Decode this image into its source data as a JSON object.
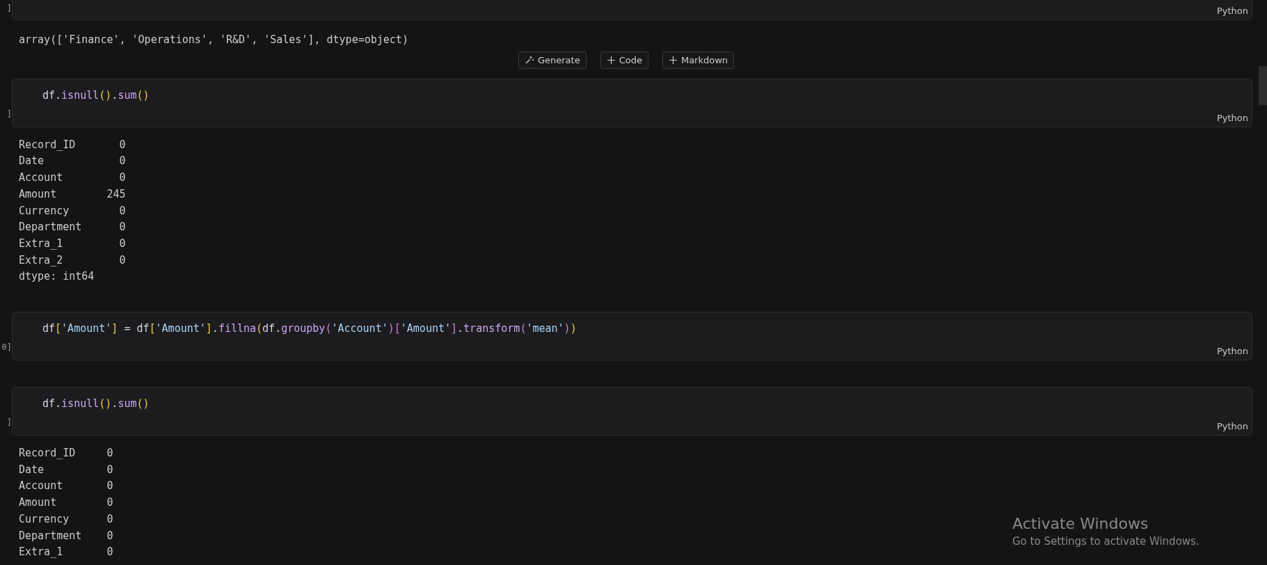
{
  "blocks": [
    {
      "kind": "code",
      "marker": "]",
      "language": "Python",
      "partial": true
    },
    {
      "kind": "output",
      "lines": [
        "array(['Finance', 'Operations', 'R&D', 'Sales'], dtype=object)"
      ]
    },
    {
      "kind": "toolbar",
      "buttons": [
        "Generate",
        "Code",
        "Markdown"
      ]
    },
    {
      "kind": "code",
      "marker": "]",
      "language": "Python",
      "tokens": [
        {
          "kind": "plain",
          "text": "df."
        },
        {
          "kind": "func",
          "text": "isnull"
        },
        {
          "kind": "bracket1",
          "text": "()"
        },
        {
          "kind": "plain",
          "text": "."
        },
        {
          "kind": "func",
          "text": "sum"
        },
        {
          "kind": "bracket1",
          "text": "()"
        }
      ]
    },
    {
      "kind": "output",
      "lines": [
        "Record_ID       0",
        "Date            0",
        "Account         0",
        "Amount        245",
        "Currency        0",
        "Department      0",
        "Extra_1         0",
        "Extra_2         0",
        "dtype: int64"
      ]
    },
    {
      "kind": "code",
      "marker": "0]",
      "language": "Python",
      "tokens": [
        {
          "kind": "plain",
          "text": "df"
        },
        {
          "kind": "bracket1",
          "text": "["
        },
        {
          "kind": "string",
          "text": "'Amount'"
        },
        {
          "kind": "bracket1",
          "text": "]"
        },
        {
          "kind": "plain",
          "text": " = df"
        },
        {
          "kind": "bracket1",
          "text": "["
        },
        {
          "kind": "string",
          "text": "'Amount'"
        },
        {
          "kind": "bracket1",
          "text": "]"
        },
        {
          "kind": "plain",
          "text": "."
        },
        {
          "kind": "func",
          "text": "fillna"
        },
        {
          "kind": "bracket1",
          "text": "("
        },
        {
          "kind": "plain",
          "text": "df."
        },
        {
          "kind": "func",
          "text": "groupby"
        },
        {
          "kind": "bracket2",
          "text": "("
        },
        {
          "kind": "string",
          "text": "'Account'"
        },
        {
          "kind": "bracket2",
          "text": ")["
        },
        {
          "kind": "string",
          "text": "'Amount'"
        },
        {
          "kind": "bracket2",
          "text": "]"
        },
        {
          "kind": "plain",
          "text": "."
        },
        {
          "kind": "func",
          "text": "transform"
        },
        {
          "kind": "bracket2",
          "text": "("
        },
        {
          "kind": "string",
          "text": "'mean'"
        },
        {
          "kind": "bracket2",
          "text": ")"
        },
        {
          "kind": "bracket1",
          "text": ")"
        }
      ]
    },
    {
      "kind": "code",
      "marker": "]",
      "language": "Python",
      "tokens": [
        {
          "kind": "plain",
          "text": "df."
        },
        {
          "kind": "func",
          "text": "isnull"
        },
        {
          "kind": "bracket1",
          "text": "()"
        },
        {
          "kind": "plain",
          "text": "."
        },
        {
          "kind": "func",
          "text": "sum"
        },
        {
          "kind": "bracket1",
          "text": "()"
        }
      ]
    },
    {
      "kind": "output",
      "lines": [
        "Record_ID     0",
        "Date          0",
        "Account       0",
        "Amount        0",
        "Currency      0",
        "Department    0",
        "Extra_1       0"
      ]
    }
  ],
  "activation": {
    "title": "Activate Windows",
    "message": "Go to Settings to activate Windows."
  }
}
